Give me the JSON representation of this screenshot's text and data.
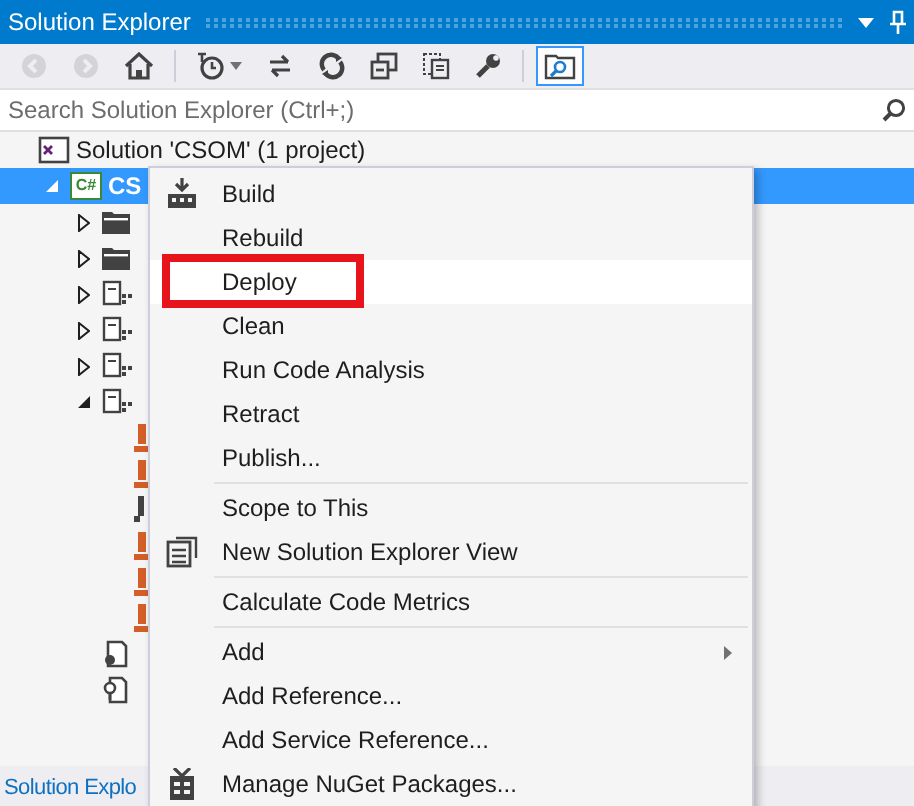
{
  "window": {
    "title": "Solution Explorer"
  },
  "toolbar": [
    {
      "selected": false,
      "disabled": true
    },
    {
      "selected": false,
      "disabled": true
    },
    {
      "selected": false,
      "disabled": false
    },
    {
      "selected": false,
      "disabled": false
    },
    {
      "selected": false,
      "disabled": false
    },
    {
      "selected": false,
      "disabled": false
    },
    {
      "selected": false,
      "disabled": false
    },
    {
      "selected": false,
      "disabled": false
    },
    {
      "selected": false,
      "disabled": false
    },
    {
      "selected": true,
      "disabled": false
    }
  ],
  "search": {
    "placeholder": "Search Solution Explorer (Ctrl+;)"
  },
  "tree": [
    {
      "kind": "solution",
      "label": "Solution 'CSOM' (1 project)",
      "selected": false,
      "children": [
        {
          "kind": "project",
          "icon_text": "C#",
          "label": "CS",
          "selected": true,
          "expanded": true,
          "children": [
            {
              "kind": "folder",
              "selected": false,
              "expanded": false
            },
            {
              "kind": "folder",
              "selected": false,
              "expanded": false
            },
            {
              "kind": "module",
              "selected": false,
              "expanded": false
            },
            {
              "kind": "module",
              "selected": false,
              "expanded": false
            },
            {
              "kind": "module",
              "selected": false,
              "expanded": false
            },
            {
              "kind": "module",
              "selected": false,
              "expanded": true,
              "children": [
                {
                  "kind": "orange-file",
                  "selected": false
                },
                {
                  "kind": "orange-file",
                  "selected": false
                },
                {
                  "kind": "dark-file",
                  "selected": false
                },
                {
                  "kind": "orange-file",
                  "selected": false
                },
                {
                  "kind": "orange-file",
                  "selected": false
                },
                {
                  "kind": "orange-file",
                  "selected": false
                }
              ]
            },
            {
              "kind": "config",
              "selected": false
            },
            {
              "kind": "key",
              "selected": false
            }
          ]
        }
      ]
    }
  ],
  "bottom_tab": {
    "label": "Solution Explo"
  },
  "context_menu": {
    "groups": [
      [
        {
          "label": "Build",
          "selected": false
        },
        {
          "label": "Rebuild",
          "selected": false
        },
        {
          "label": "Deploy",
          "selected": true
        },
        {
          "label": "Clean",
          "selected": false
        },
        {
          "label": "Run Code Analysis",
          "selected": false
        },
        {
          "label": "Retract",
          "selected": false
        },
        {
          "label": "Publish...",
          "selected": false
        }
      ],
      [
        {
          "label": "Scope to This",
          "selected": false
        },
        {
          "label": "New Solution Explorer View",
          "selected": false
        }
      ],
      [
        {
          "label": "Calculate Code Metrics",
          "selected": false
        }
      ],
      [
        {
          "label": "Add",
          "selected": false,
          "submenu": true
        },
        {
          "label": "Add Reference...",
          "selected": false
        },
        {
          "label": "Add Service Reference...",
          "selected": false
        },
        {
          "label": "Manage NuGet Packages...",
          "selected": false
        }
      ]
    ]
  }
}
